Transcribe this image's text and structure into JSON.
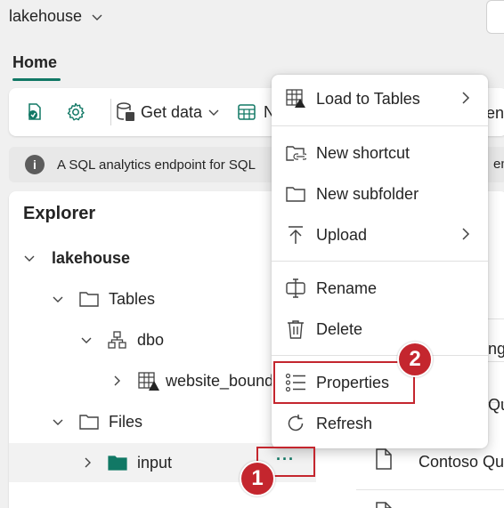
{
  "workspace": {
    "name": "lakehouse"
  },
  "tabs": [
    {
      "label": "Home",
      "active": true
    }
  ],
  "ribbon": {
    "get_data_label": "Get data",
    "new_label_partial": "N",
    "right_partial": "en"
  },
  "info_bar": {
    "text": "A SQL analytics endpoint for SQL",
    "right_partial": "em"
  },
  "explorer": {
    "title": "Explorer",
    "tree": {
      "root": "lakehouse",
      "tables": "Tables",
      "schema": "dbo",
      "table_item": "website_bound",
      "files": "Files",
      "input_folder": "input"
    },
    "more_options_label": "···"
  },
  "right_list": {
    "items": [
      "ng_",
      "Qu",
      "Contoso Qu"
    ]
  },
  "context_menu": {
    "items": [
      {
        "label": "Load to Tables",
        "icon": "table-load-icon",
        "submenu": true
      },
      {
        "label": "New shortcut",
        "icon": "folder-link-icon",
        "submenu": false
      },
      {
        "label": "New subfolder",
        "icon": "folder-icon",
        "submenu": false
      },
      {
        "label": "Upload",
        "icon": "upload-icon",
        "submenu": true
      },
      {
        "label": "Rename",
        "icon": "rename-icon",
        "submenu": false
      },
      {
        "label": "Delete",
        "icon": "trash-icon",
        "submenu": false
      },
      {
        "label": "Properties",
        "icon": "properties-list-icon",
        "submenu": false
      },
      {
        "label": "Refresh",
        "icon": "refresh-icon",
        "submenu": false
      }
    ]
  },
  "callouts": {
    "step1": "1",
    "step2": "2"
  },
  "colors": {
    "accent": "#117865",
    "callout": "#c4262e",
    "folder_fill": "#117865"
  }
}
